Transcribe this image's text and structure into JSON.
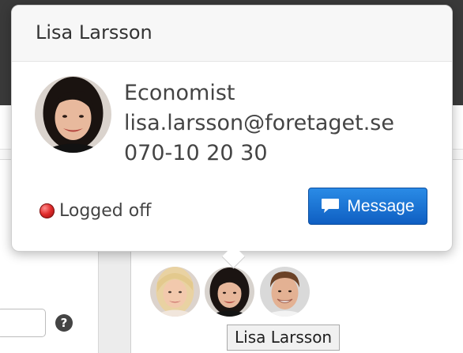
{
  "popover": {
    "title": "Lisa Larsson",
    "job_title": "Economist",
    "email": "lisa.larsson@foretaget.se",
    "phone": "070-10 20 30",
    "status": {
      "label": "Logged off",
      "color": "#d62b2b"
    },
    "message_button": {
      "label": "Message",
      "icon": "speech-bubble-icon",
      "color": "#1570d8"
    }
  },
  "tooltip": {
    "text": "Lisa Larsson"
  },
  "help": {
    "icon": "question-icon",
    "glyph": "?"
  },
  "avatars": [
    {
      "person": "blonde-woman"
    },
    {
      "person": "Lisa Larsson"
    },
    {
      "person": "smiling-man"
    }
  ]
}
